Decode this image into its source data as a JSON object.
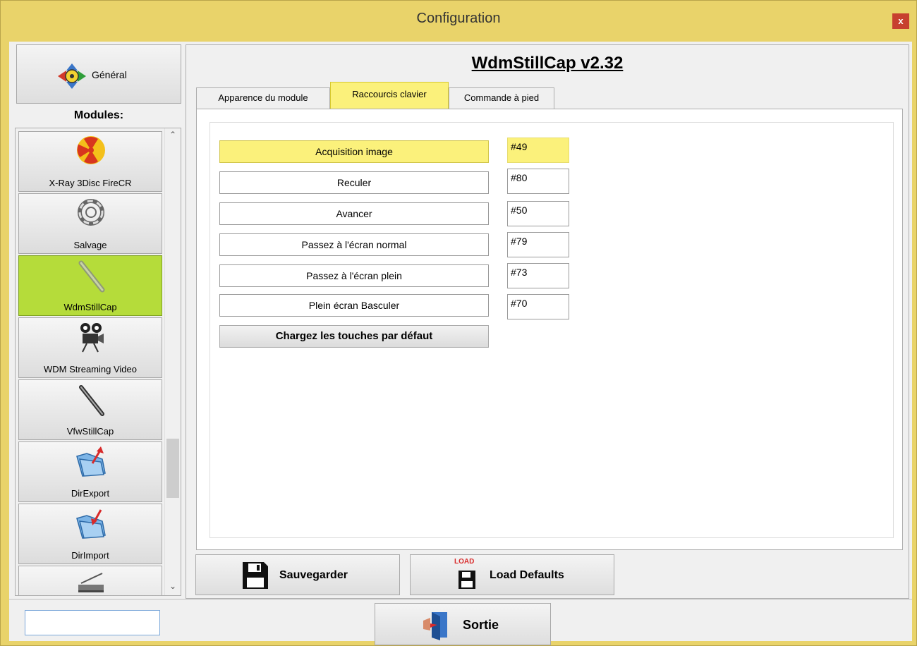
{
  "window": {
    "title": "Configuration",
    "close_label": "x"
  },
  "sidebar": {
    "general_label": "Général",
    "modules_heading": "Modules:",
    "modules": [
      {
        "label": "X-Ray 3Disc FireCR",
        "icon": "radiation-icon"
      },
      {
        "label": "Salvage",
        "icon": "lifebuoy-icon"
      },
      {
        "label": "WdmStillCap",
        "icon": "intraoral-camera-icon",
        "selected": true
      },
      {
        "label": "WDM Streaming Video",
        "icon": "film-camera-icon"
      },
      {
        "label": "VfwStillCap",
        "icon": "intraoral-camera-icon"
      },
      {
        "label": "DirExport",
        "icon": "folder-export-icon"
      },
      {
        "label": "DirImport",
        "icon": "folder-import-icon"
      },
      {
        "label": "",
        "icon": "scanner-icon"
      }
    ]
  },
  "main": {
    "module_title": "WdmStillCap v2.32",
    "tabs": [
      {
        "label": "Apparence du module"
      },
      {
        "label": "Raccourcis clavier",
        "active": true
      },
      {
        "label": "Commande à pied"
      }
    ],
    "shortcuts": [
      {
        "label": "Acquisition image",
        "value": "#49",
        "highlighted": true
      },
      {
        "label": "Reculer",
        "value": "#80"
      },
      {
        "label": "Avancer",
        "value": "#50"
      },
      {
        "label": "Passez à l'écran normal",
        "value": "#79"
      },
      {
        "label": "Passez à l'écran plein",
        "value": "#73"
      },
      {
        "label": "Plein écran Basculer",
        "value": "#70"
      }
    ],
    "defaults_button": "Chargez les touches par défaut"
  },
  "actions": {
    "save_label": "Sauvegarder",
    "load_defaults_label": "Load Defaults",
    "load_badge": "LOAD",
    "exit_label": "Sortie"
  },
  "status": {
    "input_value": ""
  },
  "colors": {
    "accent": "#e9d36a",
    "highlight": "#fbf17b",
    "selected_module": "#b5dc3a",
    "close": "#c7402f"
  }
}
